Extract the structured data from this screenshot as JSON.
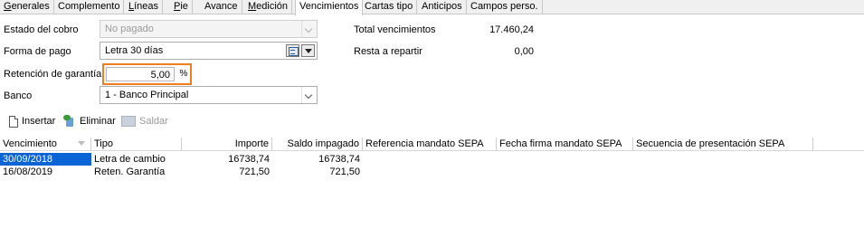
{
  "tabs": [
    {
      "label": "Generales",
      "accel": "G",
      "rest": "enerales",
      "active": false
    },
    {
      "label": "Complemento",
      "accel": "",
      "rest": "Complemento",
      "active": false
    },
    {
      "label": "Líneas",
      "accel": "L",
      "rest": "íneas",
      "active": false
    },
    {
      "label": "Pie",
      "accel": "P",
      "rest": "ie",
      "active": false
    },
    {
      "label": "Avance",
      "accel": "",
      "rest": "Avance",
      "active": false
    },
    {
      "label": "Medición",
      "accel": "M",
      "rest": "edición",
      "active": false
    },
    {
      "label": "Vencimientos",
      "accel": "",
      "rest": "Vencimientos",
      "active": true
    },
    {
      "label": "Cartas tipo",
      "accel": "",
      "rest": "Cartas tipo",
      "active": false
    },
    {
      "label": "Anticipos",
      "accel": "",
      "rest": "Anticipos",
      "active": false
    },
    {
      "label": "Campos perso.",
      "accel": "",
      "rest": "Campos perso.",
      "active": false
    }
  ],
  "form": {
    "estado_label": "Estado del cobro",
    "estado_value": "No pagado",
    "forma_label": "Forma de pago",
    "forma_value": "Letra 30 días",
    "retencion_label": "Retención de garantía",
    "retencion_value": "5,00",
    "retencion_unit": "%",
    "banco_label": "Banco",
    "banco_value": "1 - Banco Principal"
  },
  "totals": {
    "total_label": "Total vencimientos",
    "total_value": "17.460,24",
    "resta_label": "Resta a repartir",
    "resta_value": "0,00"
  },
  "toolbar": {
    "insert_label": "Insertar",
    "delete_label": "Eliminar",
    "settle_label": "Saldar"
  },
  "grid": {
    "columns": [
      "Vencimiento",
      "Tipo",
      "Importe",
      "Saldo impagado",
      "Referencia mandato SEPA",
      "Fecha firma mandato SEPA",
      "Secuencia de presentación SEPA"
    ],
    "rows": [
      {
        "vencimiento": "30/09/2018",
        "tipo": "Letra de cambio",
        "importe": "16738,74",
        "saldo": "16738,74",
        "referencia": "",
        "fecha_firma": "",
        "secuencia": ""
      },
      {
        "vencimiento": "16/08/2019",
        "tipo": "Reten. Garantía",
        "importe": "721,50",
        "saldo": "721,50",
        "referencia": "",
        "fecha_firma": "",
        "secuencia": ""
      }
    ]
  },
  "colors": {
    "accent_highlight": "#f07d1e",
    "selection": "#0a64d6"
  }
}
